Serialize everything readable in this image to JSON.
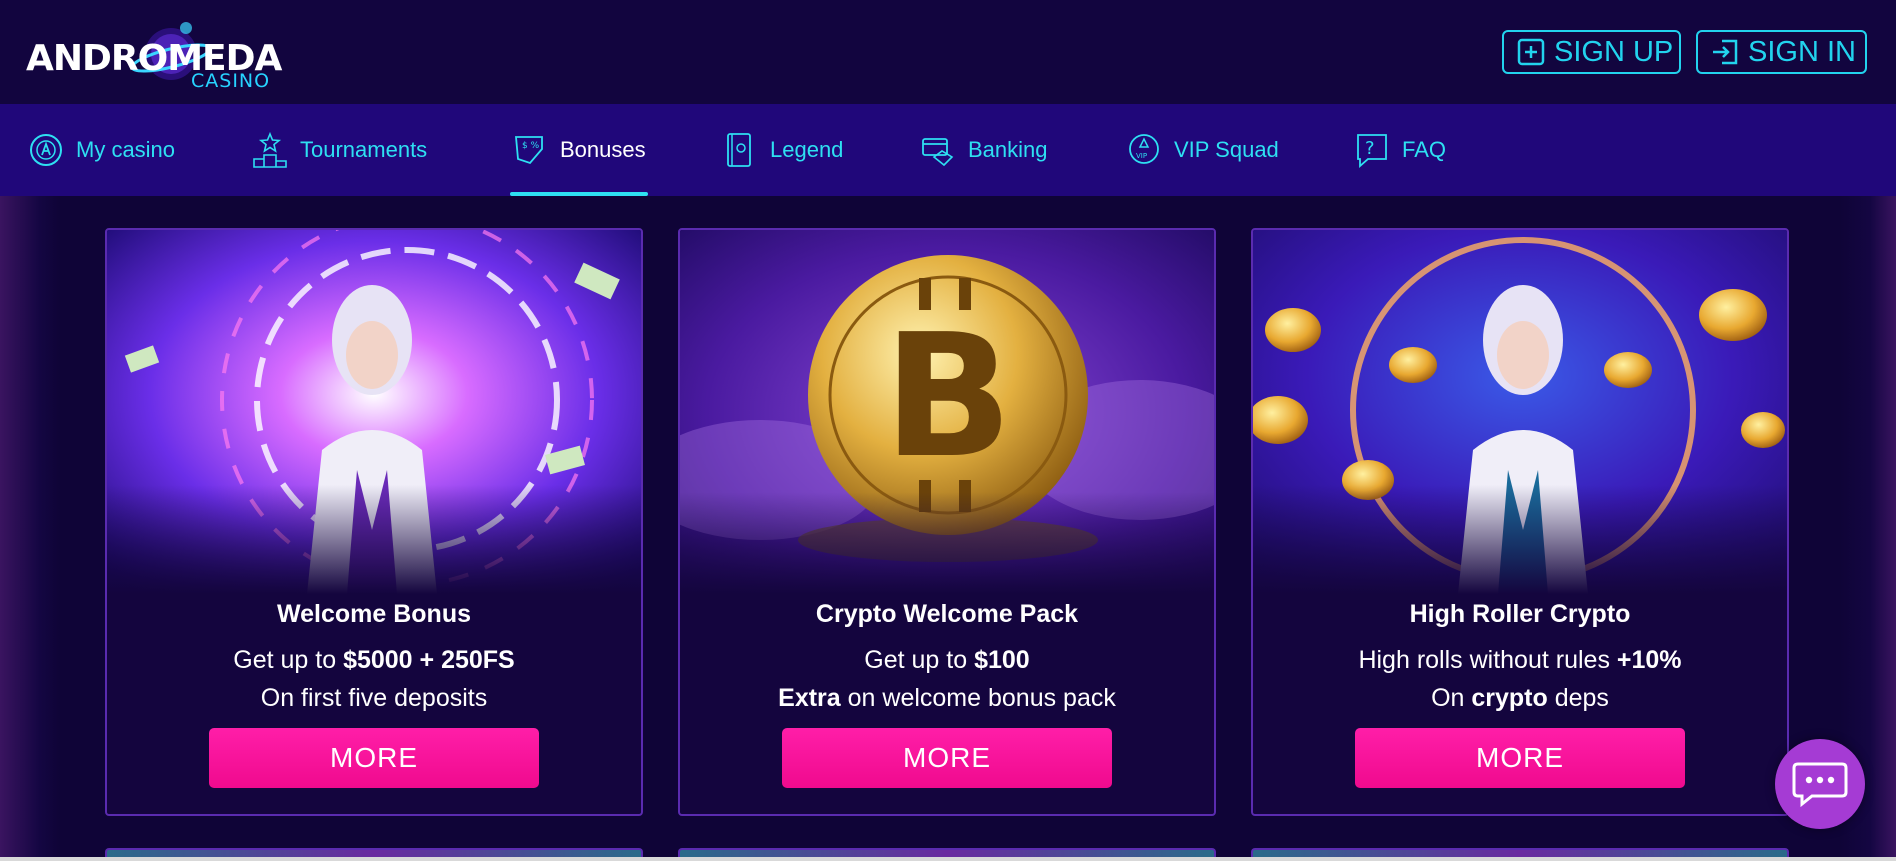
{
  "header": {
    "logo_main": "ANDROMEDA",
    "logo_sub": "CASINO",
    "signup_label": "SIGN UP",
    "signin_label": "SIGN IN"
  },
  "nav": {
    "items": [
      {
        "label": "My casino",
        "icon": "casino-chip-icon"
      },
      {
        "label": "Tournaments",
        "icon": "podium-icon"
      },
      {
        "label": "Bonuses",
        "icon": "bonus-ticket-icon",
        "active": true
      },
      {
        "label": "Legend",
        "icon": "book-icon"
      },
      {
        "label": "Banking",
        "icon": "card-icon"
      },
      {
        "label": "VIP Squad",
        "icon": "vip-badge-icon"
      },
      {
        "label": "FAQ",
        "icon": "question-icon"
      }
    ]
  },
  "cards": [
    {
      "title": "Welcome Bonus",
      "line1_pre": "Get up to ",
      "line1_bold": "$5000 + 250FS",
      "line1_post": "",
      "line2_pre": "On first five deposits",
      "line2_bold": "",
      "line2_post": "",
      "button": "MORE"
    },
    {
      "title": "Crypto Welcome Pack",
      "line1_pre": "Get up to ",
      "line1_bold": "$100",
      "line1_post": "",
      "line2_pre": "",
      "line2_bold": "Extra",
      "line2_post": " on welcome bonus pack",
      "button": "MORE"
    },
    {
      "title": "High Roller Crypto",
      "line1_pre": "High rolls without rules ",
      "line1_bold": "+10%",
      "line1_post": "",
      "line2_pre": "On ",
      "line2_bold": "crypto",
      "line2_post": " deps",
      "button": "MORE"
    }
  ],
  "colors": {
    "accent": "#22d3ee",
    "button": "#f7149a",
    "nav_bg": "#20077a",
    "page_bg": "#10043a",
    "chat": "#a53bd4"
  }
}
